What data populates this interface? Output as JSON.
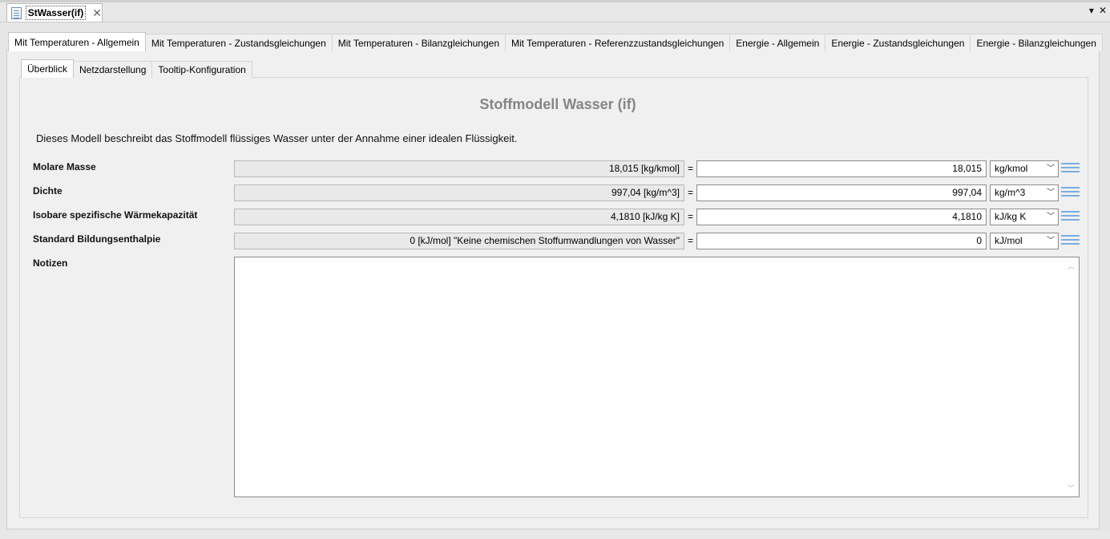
{
  "editor": {
    "tab_title": "StWasser(if)",
    "close_glyph": "✕",
    "menu_glyph": "▾",
    "close_all_glyph": "✕"
  },
  "main_tabs": [
    {
      "label": "Mit Temperaturen - Allgemein",
      "active": true
    },
    {
      "label": "Mit Temperaturen - Zustandsgleichungen",
      "active": false
    },
    {
      "label": "Mit Temperaturen - Bilanzgleichungen",
      "active": false
    },
    {
      "label": "Mit Temperaturen - Referenzzustandsgleichungen",
      "active": false
    },
    {
      "label": "Energie - Allgemein",
      "active": false
    },
    {
      "label": "Energie - Zustandsgleichungen",
      "active": false
    },
    {
      "label": "Energie - Bilanzgleichungen",
      "active": false
    }
  ],
  "sub_tabs": [
    {
      "label": "Überblick",
      "active": true
    },
    {
      "label": "Netzdarstellung",
      "active": false
    },
    {
      "label": "Tooltip-Konfiguration",
      "active": false
    }
  ],
  "page": {
    "title": "Stoffmodell Wasser (if)",
    "description": "Dieses Modell beschreibt das Stoffmodell flüssiges Wasser unter der Annahme einer idealen Flüssigkeit."
  },
  "properties": [
    {
      "label": "Molare Masse",
      "display": "18,015 [kg/kmol]",
      "value": "18,015",
      "unit": "kg/kmol"
    },
    {
      "label": "Dichte",
      "display": "997,04 [kg/m^3]",
      "value": "997,04",
      "unit": "kg/m^3"
    },
    {
      "label": "Isobare spezifische Wärmekapazität",
      "display": "4,1810 [kJ/kg K]",
      "value": "4,1810",
      "unit": "kJ/kg K"
    },
    {
      "label": "Standard Bildungsenthalpie",
      "display": "0 [kJ/mol] \"Keine chemischen Stoffumwandlungen von Wasser\"",
      "value": "0",
      "unit": "kJ/mol"
    }
  ],
  "equals_sign": "=",
  "notes": {
    "label": "Notizen",
    "content": ""
  },
  "colors": {
    "title_gray": "#858585",
    "list_icon_blue": "#7aaee0"
  }
}
